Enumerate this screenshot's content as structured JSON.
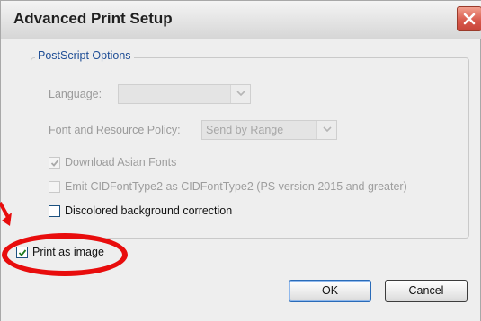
{
  "dialog": {
    "title": "Advanced Print Setup",
    "accent_close": "#d7574a"
  },
  "postscript": {
    "legend": "PostScript Options",
    "language_label": "Language:",
    "language_value": "",
    "font_policy_label": "Font and Resource Policy:",
    "font_policy_value": "Send by Range",
    "download_asian_fonts": {
      "label": "Download Asian Fonts",
      "checked": true,
      "enabled": false
    },
    "emit_cid": {
      "label": "Emit CIDFontType2 as CIDFontType2 (PS version 2015 and greater)",
      "checked": false,
      "enabled": false
    },
    "discolored_bg": {
      "label": "Discolored background correction",
      "checked": false,
      "enabled": true
    }
  },
  "print_as_image": {
    "label": "Print as image",
    "checked": true,
    "enabled": true
  },
  "buttons": {
    "ok": "OK",
    "cancel": "Cancel"
  },
  "annotation_color": "#e80d0d"
}
